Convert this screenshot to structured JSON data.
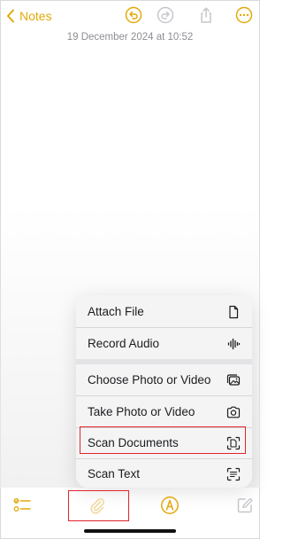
{
  "colors": {
    "accent": "#e2a90b",
    "highlight": "#e0242b",
    "muted": "#8e8e93"
  },
  "nav": {
    "back_label": "Notes",
    "back_icon": "chevron-left-icon",
    "undo_icon": "undo-icon",
    "redo_icon": "redo-icon",
    "share_icon": "share-icon",
    "more_icon": "ellipsis-circle-icon"
  },
  "note": {
    "timestamp": "19 December 2024 at 10:52"
  },
  "attach_menu": {
    "items": [
      {
        "label": "Attach File",
        "icon": "document-icon"
      },
      {
        "label": "Record Audio",
        "icon": "waveform-icon"
      },
      {
        "label": "Choose Photo or Video",
        "icon": "photo-library-icon"
      },
      {
        "label": "Take Photo or Video",
        "icon": "camera-icon"
      },
      {
        "label": "Scan Documents",
        "icon": "doc-scanner-icon"
      },
      {
        "label": "Scan Text",
        "icon": "text-scan-icon"
      }
    ]
  },
  "toolbar": {
    "checklist_icon": "checklist-icon",
    "attach_icon": "paperclip-icon",
    "markup_icon": "markup-pen-icon",
    "compose_icon": "compose-icon"
  }
}
